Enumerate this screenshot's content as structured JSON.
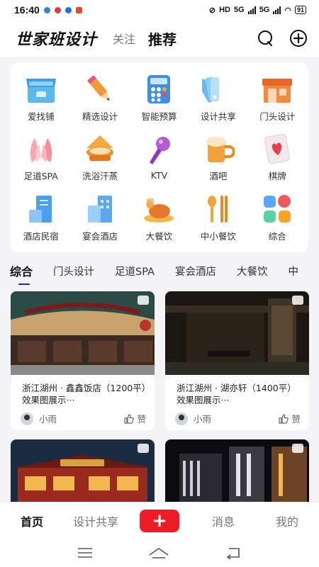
{
  "status_bar": {
    "time": "16:40",
    "network1": "HD",
    "network2": "5G",
    "network3": "5G",
    "battery": "91"
  },
  "header": {
    "logo": "世家班设计",
    "tab_follow": "关注",
    "tab_recommend": "推荐",
    "icons": [
      "chat-icon",
      "plus-circle-icon"
    ]
  },
  "categories": [
    {
      "label": "爱找铺",
      "icon": "shop-icon"
    },
    {
      "label": "精选设计",
      "icon": "pencil-icon"
    },
    {
      "label": "智能预算",
      "icon": "calculator-icon"
    },
    {
      "label": "设计共享",
      "icon": "swatch-icon"
    },
    {
      "label": "门头设计",
      "icon": "storefront-icon"
    },
    {
      "label": "足道SPA",
      "icon": "spa-hands-icon"
    },
    {
      "label": "洗浴汗蒸",
      "icon": "bath-icon"
    },
    {
      "label": "KTV",
      "icon": "microphone-icon"
    },
    {
      "label": "酒吧",
      "icon": "beer-icon"
    },
    {
      "label": "棋牌",
      "icon": "card-icon"
    },
    {
      "label": "酒店民宿",
      "icon": "hotel-icon"
    },
    {
      "label": "宴会酒店",
      "icon": "building-icon"
    },
    {
      "label": "大餐饮",
      "icon": "roast-chicken-icon"
    },
    {
      "label": "中小餐饮",
      "icon": "cutlery-icon"
    },
    {
      "label": "综合",
      "icon": "grid-icon"
    }
  ],
  "filters": [
    "综合",
    "门头设计",
    "足道SPA",
    "宴会酒店",
    "大餐饮",
    "中"
  ],
  "feed": [
    {
      "title": "浙江湖州 · 鑫鑫饭店（1200平）效果图展示···",
      "author": "小雨",
      "like": "赞"
    },
    {
      "title": "浙江湖州 · 湖亦轩（1400平）效果图展示···",
      "author": "小雨",
      "like": "赞"
    }
  ],
  "tabbar": {
    "home": "首页",
    "share": "设计共享",
    "add": "+",
    "messages": "消息",
    "mine": "我的"
  },
  "colors": {
    "accent_red": "#ee1c25",
    "active_underline": "#2a2a8c"
  }
}
